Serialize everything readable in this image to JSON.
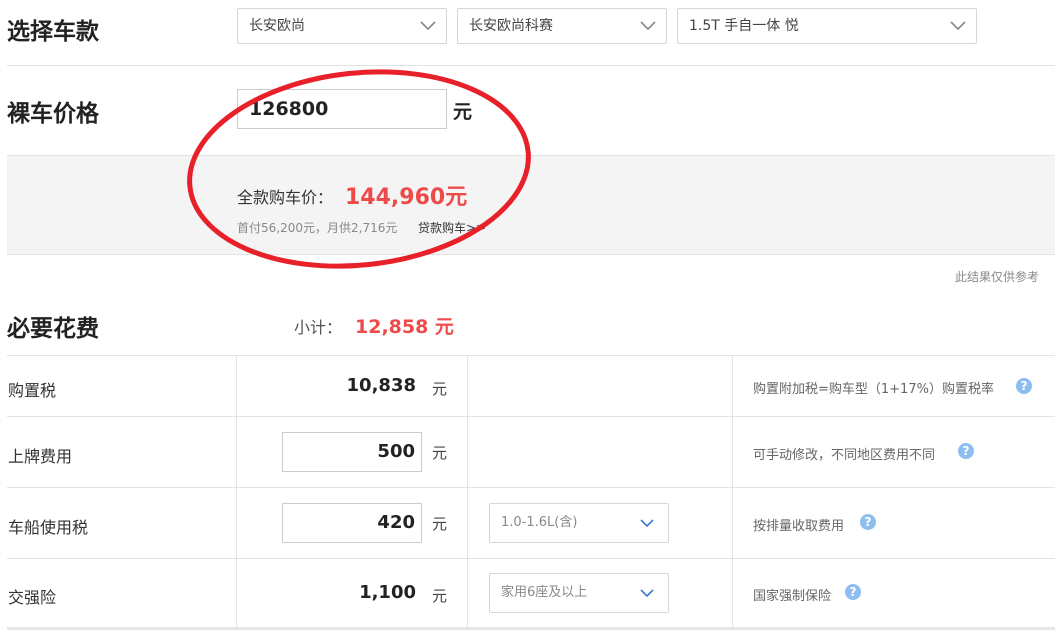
{
  "select_model": {
    "title": "选择车款",
    "brand": "长安欧尚",
    "series": "长安欧尚科赛",
    "trim": "1.5T 手自一体 悦"
  },
  "bare_price": {
    "title": "裸车价格",
    "value": "126800",
    "unit": "元"
  },
  "summary": {
    "full_label": "全款购车价：",
    "full_value": "144,960元",
    "down_payment": "首付56,200元，月供2,716元",
    "loan_link": "贷款购车>>",
    "disclaimer": "此结果仅供参考"
  },
  "required": {
    "title": "必要花费",
    "subtotal_label": "小计：",
    "subtotal_value": "12,858 元",
    "rows": [
      {
        "label": "购置税",
        "value": "10,838",
        "unit": "元",
        "note": "购置附加税=购车型（1+17%）购置税率"
      },
      {
        "label": "上牌费用",
        "value": "500",
        "unit": "元",
        "note": "可手动修改，不同地区费用不同"
      },
      {
        "label": "车船使用税",
        "value": "420",
        "unit": "元",
        "option": "1.0-1.6L(含)",
        "note": "按排量收取费用"
      },
      {
        "label": "交强险",
        "value": "1,100",
        "unit": "元",
        "option": "家用6座及以上",
        "note": "国家强制保险"
      }
    ]
  },
  "icons": {
    "chevron": "chevron-down-icon",
    "help": "question-icon"
  },
  "colors": {
    "accent_red": "#ef4a4a",
    "help_blue": "#8ebdf0",
    "annotation_circle": "#e8202a"
  }
}
